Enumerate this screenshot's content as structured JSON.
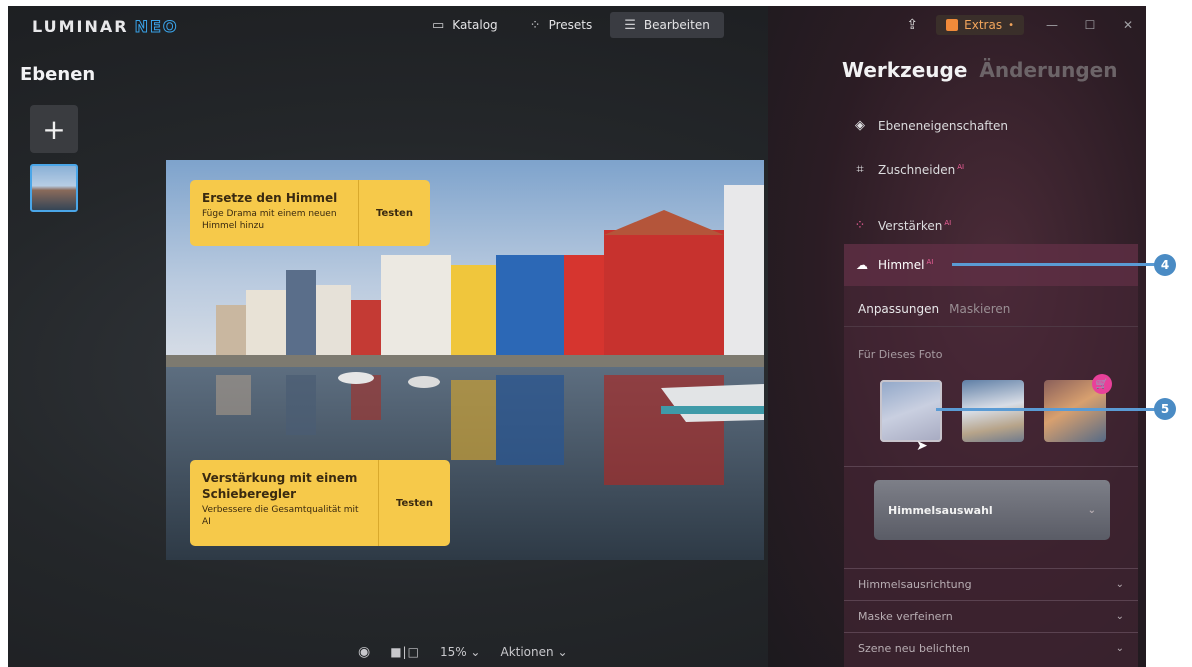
{
  "app": {
    "logo_main": "LUMINAR",
    "logo_neo": "NEO"
  },
  "modes": [
    {
      "label": "Katalog",
      "icon": "folder-icon"
    },
    {
      "label": "Presets",
      "icon": "sparkle-icon"
    },
    {
      "label": "Bearbeiten",
      "icon": "sliders-icon",
      "active": true
    }
  ],
  "window": {
    "extras_label": "Extras",
    "extras_badge": "•"
  },
  "layers": {
    "title": "Ebenen",
    "add_label": "+"
  },
  "canvas": {
    "promo1": {
      "title": "Ersetze den Himmel",
      "desc": "Füge Drama mit einem neuen Himmel hinzu",
      "button": "Testen"
    },
    "promo2": {
      "title": "Verstärkung mit einem Schieberegler",
      "desc": "Verbessere die Gesamtqualität mit AI",
      "button": "Testen"
    }
  },
  "bottombar": {
    "zoom": "15%",
    "actions": "Aktionen"
  },
  "panel": {
    "tab_tools": "Werkzeuge",
    "tab_changes": "Änderungen",
    "tools": [
      {
        "label": "Ebeneneigenschaften",
        "icon": "layers-icon",
        "ai": ""
      },
      {
        "label": "Zuschneiden",
        "icon": "crop-icon",
        "ai": "AI"
      },
      {
        "label": "Verstärken",
        "icon": "sparkle-icon",
        "ai": "AI"
      }
    ],
    "sky": {
      "label": "Himmel",
      "ai": "AI",
      "subtab_adjust": "Anpassungen",
      "subtab_mask": "Maskieren",
      "for_photo": "Für Dieses Foto",
      "select_label": "Himmelsauswahl",
      "sections": [
        "Himmelsausrichtung",
        "Maske verfeinern",
        "Szene neu belichten"
      ]
    }
  },
  "callouts": {
    "c4": "4",
    "c5": "5"
  },
  "colors": {
    "accent_blue": "#4a8bc4",
    "promo_yellow": "#f6c94a",
    "ai_pink": "#f0609a"
  }
}
